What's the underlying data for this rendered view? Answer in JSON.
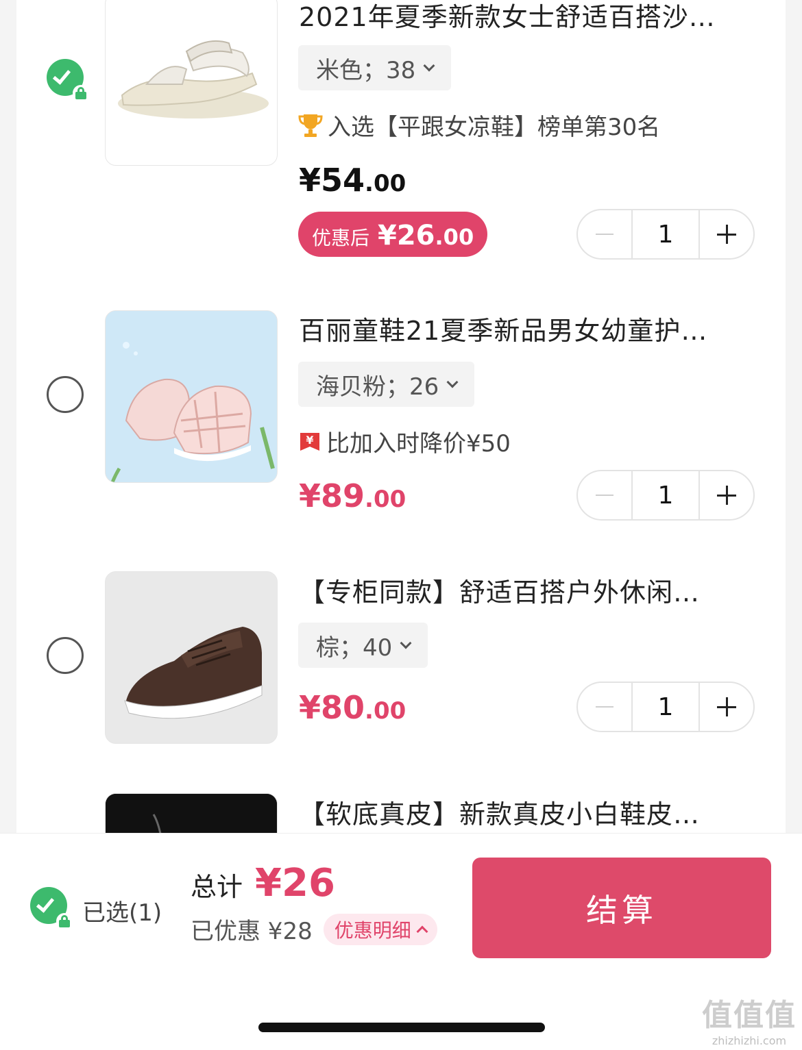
{
  "items": [
    {
      "checked": true,
      "title": "2021年夏季新款女士舒适百搭沙…",
      "spec": "米色；38",
      "tag_icon": "trophy-icon",
      "tag": "入选【平跟女凉鞋】榜单第30名",
      "price_int": "¥54",
      "price_dec": ".00",
      "discount_label": "优惠后",
      "discount_int": "¥26",
      "discount_dec": ".00",
      "qty": "1"
    },
    {
      "checked": false,
      "title": "百丽童鞋21夏季新品男女幼童护…",
      "spec": "海贝粉；26",
      "tag_icon": "price-drop-icon",
      "tag": "比加入时降价¥50",
      "price_int": "¥89",
      "price_dec": ".00",
      "qty": "1"
    },
    {
      "checked": false,
      "title": "【专柜同款】舒适百搭户外休闲…",
      "spec": "棕；40",
      "price_int": "¥80",
      "price_dec": ".00",
      "qty": "1"
    },
    {
      "checked": false,
      "title": "【软底真皮】新款真皮小白鞋皮…"
    }
  ],
  "bottom_bar": {
    "selected_label": "已选(1)",
    "total_label": "总计",
    "total_value": "¥26",
    "saved_label": "已优惠 ¥28",
    "detail_label": "优惠明细",
    "checkout_label": "结算"
  },
  "watermark": {
    "logo": "值值值",
    "url": "zhizhizhi.com"
  },
  "colors": {
    "accent": "#e0446a",
    "checkout": "#de4a6a",
    "check_green": "#3dba6d"
  }
}
